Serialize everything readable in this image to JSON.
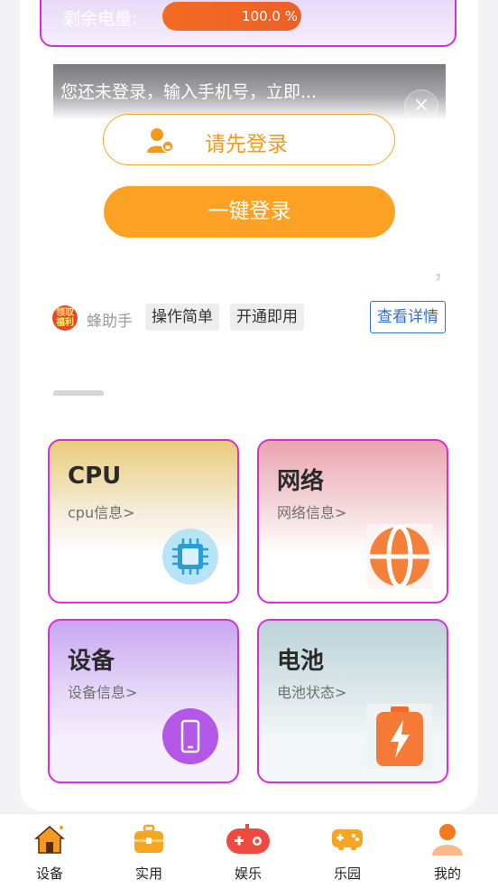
{
  "battery": {
    "label": "剩余电量:",
    "value": "100.0 %"
  },
  "login": {
    "prompt": "您还未登录，输入手机号，立即...",
    "close_symbol": "×",
    "pre_login_label": "请先登录",
    "one_click_label": "一键登录"
  },
  "ad": {
    "badge_text": "领取福利",
    "name": "蜂助手",
    "tags": [
      "操作简单",
      "开通即用"
    ],
    "detail_label": "查看详情"
  },
  "cards": [
    {
      "title": "CPU",
      "subtitle": "cpu信息>",
      "icon": "chip-icon"
    },
    {
      "title": "网络",
      "subtitle": "网络信息>",
      "icon": "globe-icon"
    },
    {
      "title": "设备",
      "subtitle": "设备信息>",
      "icon": "phone-icon"
    },
    {
      "title": "电池",
      "subtitle": "电池状态>",
      "icon": "battery-icon"
    }
  ],
  "tabs": [
    {
      "label": "设备",
      "icon": "house-icon"
    },
    {
      "label": "实用",
      "icon": "toolbox-icon"
    },
    {
      "label": "娱乐",
      "icon": "gamepad-icon"
    },
    {
      "label": "乐园",
      "icon": "game-controller-icon"
    },
    {
      "label": "我的",
      "icon": "profile-icon"
    }
  ],
  "colors": {
    "accent": "#fba224",
    "card_border": "#d631d6",
    "link": "#2f6fd6"
  }
}
